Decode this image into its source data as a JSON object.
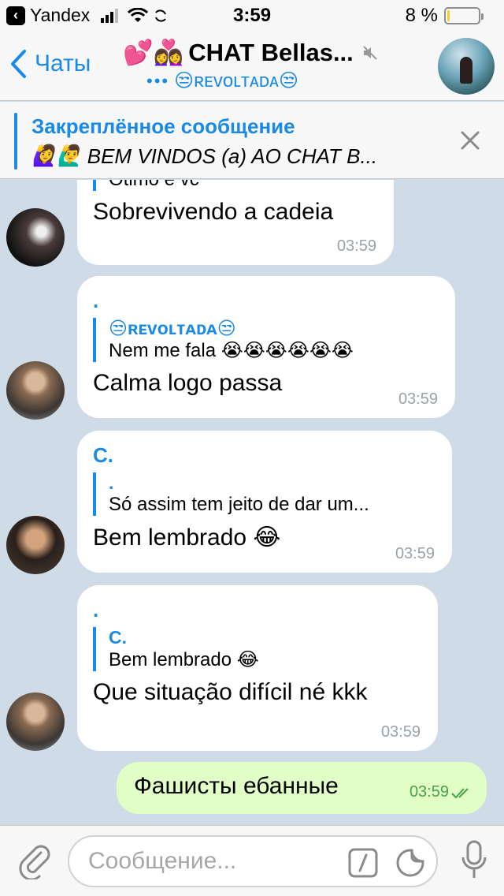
{
  "status": {
    "carrier": "Yandex",
    "time": "3:59",
    "battery_percent": "8 %",
    "battery_level": 0.08,
    "battery_color": "#f5d02b"
  },
  "nav": {
    "back_label": "Чаты",
    "title": "CHAT Bellas...",
    "title_emoji": "💕👩‍❤️‍👩",
    "subtitle": "😒ʀᴇᴠᴏʟᴛᴀᴅᴀ😒",
    "typing": "•••"
  },
  "pinned": {
    "title": "Закреплённое сообщение",
    "emoji": "🙋‍♀️🙋‍♂️",
    "text": "BEM VINDOS (a) AO CHAT B..."
  },
  "messages": [
    {
      "reply_text": "Otimo e vc",
      "text": "Sobrevivendo a cadeia",
      "time": "03:59"
    },
    {
      "sender": ".",
      "reply_name": "😒ʀᴇᴠᴏʟᴛᴀᴅᴀ😒",
      "reply_text": "Nem me fala 😭😭😭😭😭😭",
      "text": "Calma logo passa",
      "time": "03:59"
    },
    {
      "sender": "C.",
      "reply_name": ".",
      "reply_text": "Só assim tem jeito de dar um...",
      "text": "Bem lembrado 😂",
      "time": "03:59"
    },
    {
      "sender": ".",
      "reply_name": "C.",
      "reply_text": "Bem lembrado 😂",
      "text": "Que situação difícil né kkk",
      "time": "03:59"
    },
    {
      "text": "Фашисты ебанные",
      "time": "03:59"
    }
  ],
  "input": {
    "placeholder": "Сообщение..."
  },
  "colors": {
    "accent": "#1a8ae6",
    "outgoing_bubble": "#e1fec6",
    "chat_background": "#cfdbe6"
  }
}
